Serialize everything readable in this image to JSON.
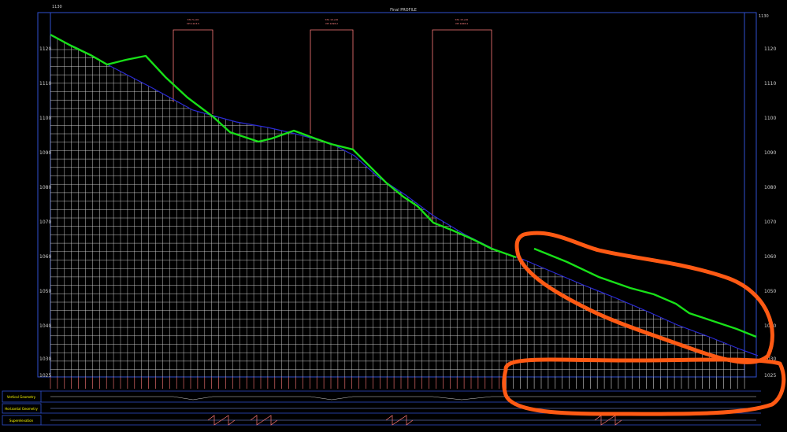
{
  "header": {
    "title": "Final PROFILE",
    "corner_label_left": "1130",
    "corner_label_right": "1130"
  },
  "axis": {
    "left_labels": [
      "1120",
      "1110",
      "1100",
      "1090",
      "1080",
      "1070",
      "1060",
      "1050",
      "1040",
      "1030",
      "1025"
    ],
    "right_labels": [
      "1120",
      "1110",
      "1100",
      "1090",
      "1080",
      "1070",
      "1060",
      "1050",
      "1040",
      "1030",
      "1025"
    ]
  },
  "vpi_callouts": [
    {
      "label": "STA 5+00",
      "sub": "VPI 1103.5"
    },
    {
      "label": "STA 10+00",
      "sub": "VPI 1098.2"
    },
    {
      "label": "STA 15+00",
      "sub": "VPI 1068.4"
    }
  ],
  "bands": {
    "vertical_geometry": "Vertical Geometry",
    "horizontal_geometry": "Horizontal Geometry",
    "superelevation": "Superelevation"
  },
  "colors": {
    "background": "#000000",
    "frame": "#2f4fd0",
    "grid": "#d9d9d9",
    "ground_line": "#2a2ad6",
    "design_line": "#18e018",
    "callout": "#ff7a7a",
    "markup": "#ff5a14",
    "band_label": "#ffff00"
  }
}
